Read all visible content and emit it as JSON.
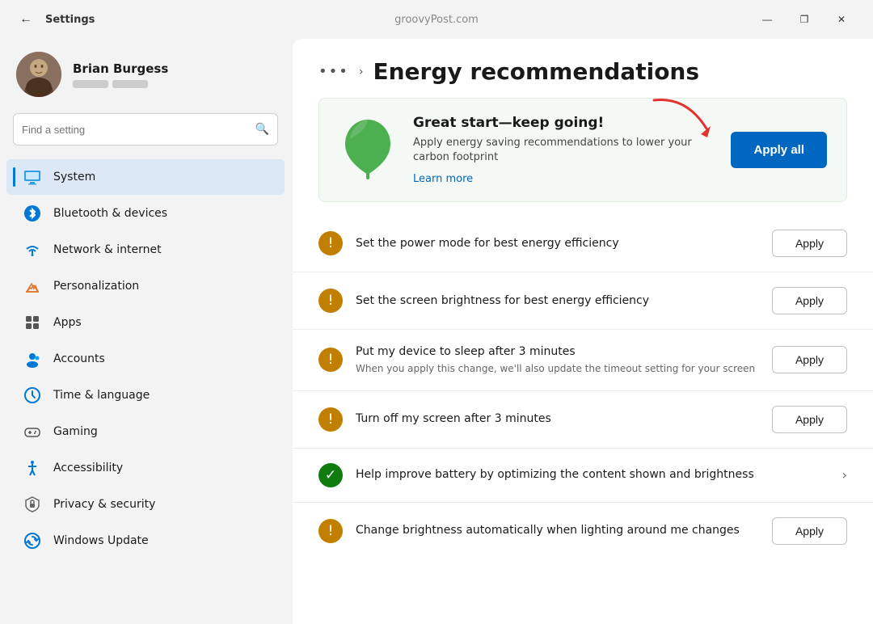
{
  "window": {
    "title": "Settings",
    "site": "groovyPost.com",
    "controls": {
      "minimize": "—",
      "maximize": "❐",
      "close": "✕"
    }
  },
  "sidebar": {
    "search_placeholder": "Find a setting",
    "user": {
      "name": "Brian Burgess"
    },
    "items": [
      {
        "id": "system",
        "label": "System",
        "active": true
      },
      {
        "id": "bluetooth",
        "label": "Bluetooth & devices",
        "active": false
      },
      {
        "id": "network",
        "label": "Network & internet",
        "active": false
      },
      {
        "id": "personalization",
        "label": "Personalization",
        "active": false
      },
      {
        "id": "apps",
        "label": "Apps",
        "active": false
      },
      {
        "id": "accounts",
        "label": "Accounts",
        "active": false
      },
      {
        "id": "time",
        "label": "Time & language",
        "active": false
      },
      {
        "id": "gaming",
        "label": "Gaming",
        "active": false
      },
      {
        "id": "accessibility",
        "label": "Accessibility",
        "active": false
      },
      {
        "id": "privacy",
        "label": "Privacy & security",
        "active": false
      },
      {
        "id": "update",
        "label": "Windows Update",
        "active": false
      }
    ]
  },
  "content": {
    "breadcrumb_dots": "•••",
    "breadcrumb_arrow": "›",
    "page_title": "Energy recommendations",
    "hero": {
      "title": "Great start—keep going!",
      "description": "Apply energy saving recommendations to lower your carbon footprint",
      "learn_more": "Learn more",
      "apply_all_label": "Apply all"
    },
    "recommendations": [
      {
        "id": "power-mode",
        "icon_type": "warning",
        "label": "Set the power mode for best energy efficiency",
        "sublabel": "",
        "has_apply": true,
        "has_chevron": false,
        "apply_label": "Apply"
      },
      {
        "id": "screen-brightness",
        "icon_type": "warning",
        "label": "Set the screen brightness for best energy efficiency",
        "sublabel": "",
        "has_apply": true,
        "has_chevron": false,
        "apply_label": "Apply"
      },
      {
        "id": "sleep",
        "icon_type": "warning",
        "label": "Put my device to sleep after 3 minutes",
        "sublabel": "When you apply this change, we'll also update the timeout setting for your screen",
        "has_apply": true,
        "has_chevron": false,
        "apply_label": "Apply"
      },
      {
        "id": "screen-off",
        "icon_type": "warning",
        "label": "Turn off my screen after 3 minutes",
        "sublabel": "",
        "has_apply": true,
        "has_chevron": false,
        "apply_label": "Apply"
      },
      {
        "id": "battery-optimize",
        "icon_type": "success",
        "label": "Help improve battery by optimizing the content shown and brightness",
        "sublabel": "",
        "has_apply": false,
        "has_chevron": true,
        "apply_label": ""
      },
      {
        "id": "auto-brightness",
        "icon_type": "warning",
        "label": "Change brightness automatically when lighting around me changes",
        "sublabel": "",
        "has_apply": true,
        "has_chevron": false,
        "apply_label": "Apply"
      }
    ]
  }
}
